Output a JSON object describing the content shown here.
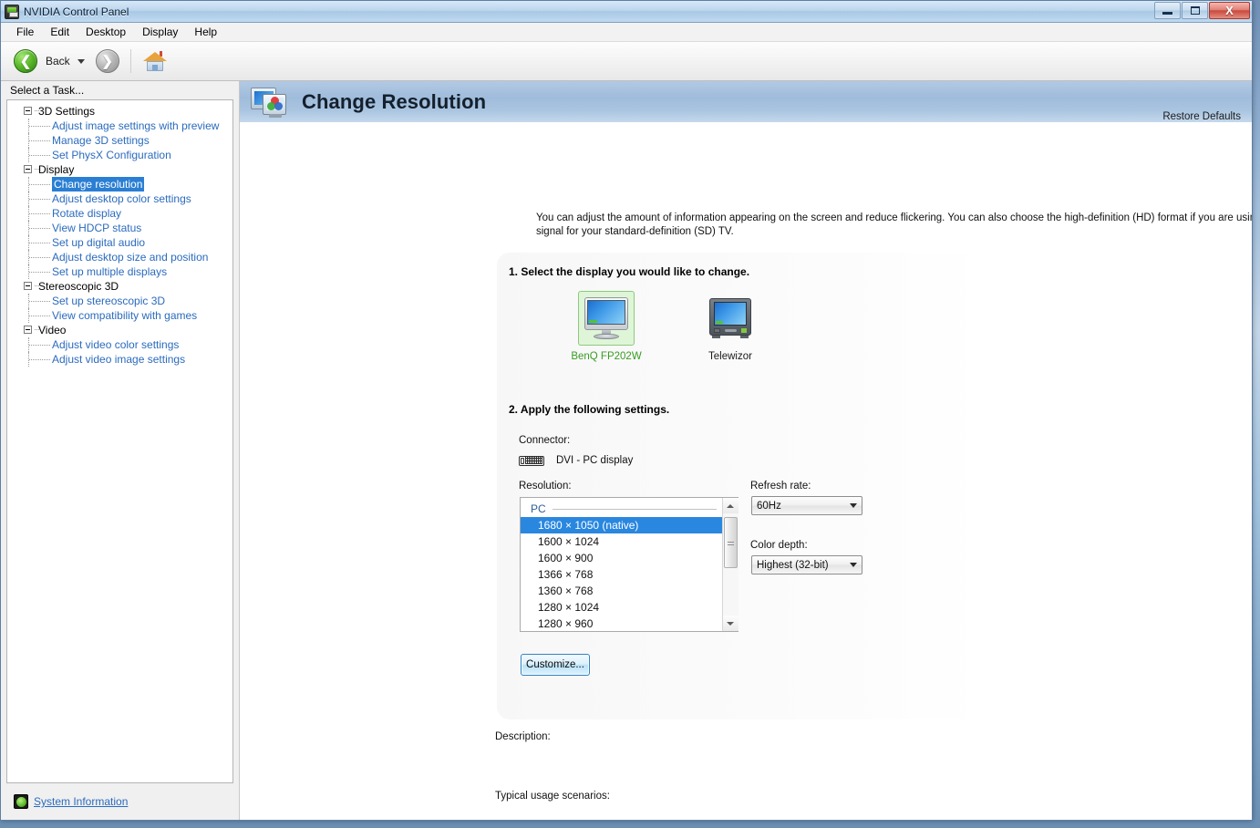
{
  "window": {
    "title": "NVIDIA Control Panel",
    "icon": "nvidia-icon",
    "buttons": {
      "minimize": "minimize-icon",
      "maximize": "maximize-icon",
      "close": "X"
    }
  },
  "menubar": {
    "items": [
      "File",
      "Edit",
      "Desktop",
      "Display",
      "Help"
    ]
  },
  "toolbar": {
    "back_label": "Back",
    "back_icon": "back-arrow-icon",
    "dropdown_icon": "chevron-down-icon",
    "forward_icon": "forward-arrow-icon",
    "home_icon": "home-icon"
  },
  "sidebar": {
    "header": "Select a Task...",
    "groups": [
      {
        "label": "3D Settings",
        "children": [
          "Adjust image settings with preview",
          "Manage 3D settings",
          "Set PhysX Configuration"
        ]
      },
      {
        "label": "Display",
        "children": [
          "Change resolution",
          "Adjust desktop color settings",
          "Rotate display",
          "View HDCP status",
          "Set up digital audio",
          "Adjust desktop size and position",
          "Set up multiple displays"
        ],
        "selected": "Change resolution"
      },
      {
        "label": "Stereoscopic 3D",
        "children": [
          "Set up stereoscopic 3D",
          "View compatibility with games"
        ]
      },
      {
        "label": "Video",
        "children": [
          "Adjust video color settings",
          "Adjust video image settings"
        ]
      }
    ],
    "system_information": "System Information",
    "system_information_icon": "info-icon"
  },
  "page": {
    "title": "Change Resolution",
    "title_icon": "display-color-icon",
    "restore_defaults": "Restore Defaults",
    "intro": "You can adjust the amount of information appearing on the screen and reduce flickering. You can also choose the high-definition (HD) format if you are using an HDTV and set a country-specific signal for your standard-definition (SD) TV."
  },
  "step1": {
    "label": "1. Select the display you would like to change.",
    "displays": [
      {
        "name": "BenQ FP202W",
        "type": "lcd-monitor-icon",
        "selected": true
      },
      {
        "name": "Telewizor",
        "type": "crt-tv-icon",
        "selected": false
      }
    ]
  },
  "step2": {
    "label": "2. Apply the following settings.",
    "connector_label": "Connector:",
    "connector_icon": "dvi-connector-icon",
    "connector_value": "DVI - PC display",
    "resolution_label": "Resolution:",
    "resolution_group": "PC",
    "resolutions": [
      "1680 × 1050 (native)",
      "1600 × 1024",
      "1600 × 900",
      "1366 × 768",
      "1360 × 768",
      "1280 × 1024",
      "1280 × 960"
    ],
    "resolution_selected": "1680 × 1050 (native)",
    "refresh_rate_label": "Refresh rate:",
    "refresh_rate_value": "60Hz",
    "color_depth_label": "Color depth:",
    "color_depth_value": "Highest (32-bit)",
    "customize_button": "Customize..."
  },
  "footer": {
    "description_label": "Description:",
    "usage_label": "Typical usage scenarios:"
  },
  "colors": {
    "selection_blue": "#2a87e0",
    "link_blue": "#2b6bbd",
    "selected_display_green": "#3a9c23",
    "header_gradient_top": "#b2c9e3",
    "title_bar_blue": "#a9c9e6"
  }
}
